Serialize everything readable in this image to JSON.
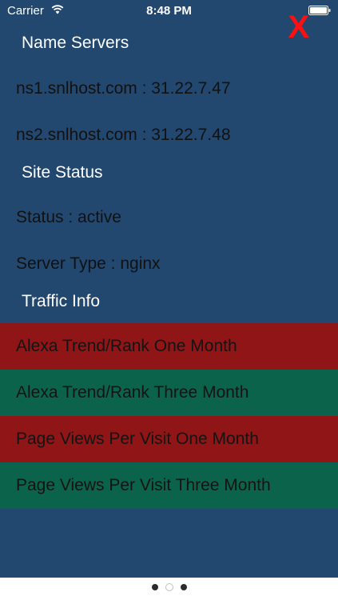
{
  "status_bar": {
    "carrier": "Carrier",
    "time": "8:48 PM"
  },
  "close_label": "X",
  "sections": {
    "name_servers": {
      "heading": "Name Servers",
      "lines": [
        "ns1.snlhost.com : 31.22.7.47",
        "ns2.snlhost.com : 31.22.7.48"
      ]
    },
    "site_status": {
      "heading": "Site Status",
      "lines": [
        "Status : active",
        "Server Type : nginx"
      ]
    },
    "traffic_info": {
      "heading": "Traffic Info",
      "rows": [
        {
          "label": "Alexa Trend/Rank One Month",
          "color": "#8f1516"
        },
        {
          "label": "Alexa Trend/Rank Three Month",
          "color": "#0a634a"
        },
        {
          "label": "Page Views Per Visit One Month",
          "color": "#8f1516"
        },
        {
          "label": "Page Views Per Visit Three Month",
          "color": "#0a634a"
        }
      ]
    }
  },
  "page_control": {
    "pages": 3,
    "current": 2
  }
}
